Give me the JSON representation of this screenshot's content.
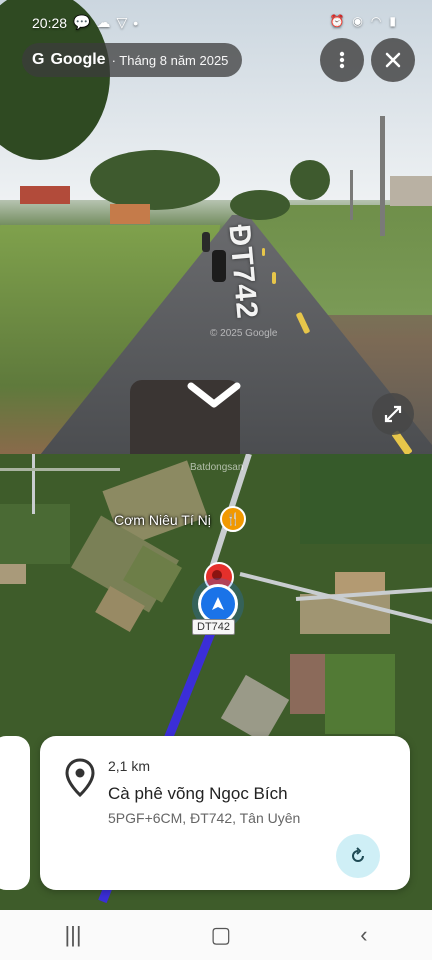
{
  "status": {
    "time": "20:28"
  },
  "streetview": {
    "brand": "Google",
    "date": "· Tháng 8 năm 2025",
    "road_marking": "ĐT742",
    "copyright": "© 2025 Google"
  },
  "map": {
    "poi_name": "Cơm Niêu Tí Nị",
    "road_shield": "DT742",
    "watermark": "Batdongsan"
  },
  "place_card": {
    "distance": "2,1 km",
    "name": "Cà phê võng Ngọc Bích",
    "address": "5PGF+6CM, ĐT742, Tân Uyên"
  },
  "colors": {
    "route": "#3b2ed8",
    "location_dot": "#1a73e8",
    "pin": "#e5302b"
  },
  "icons": [
    "more-vert-icon",
    "close-icon",
    "expand-icon",
    "chevron-down-icon",
    "location-pin-icon",
    "refresh-icon",
    "restaurant-icon"
  ]
}
